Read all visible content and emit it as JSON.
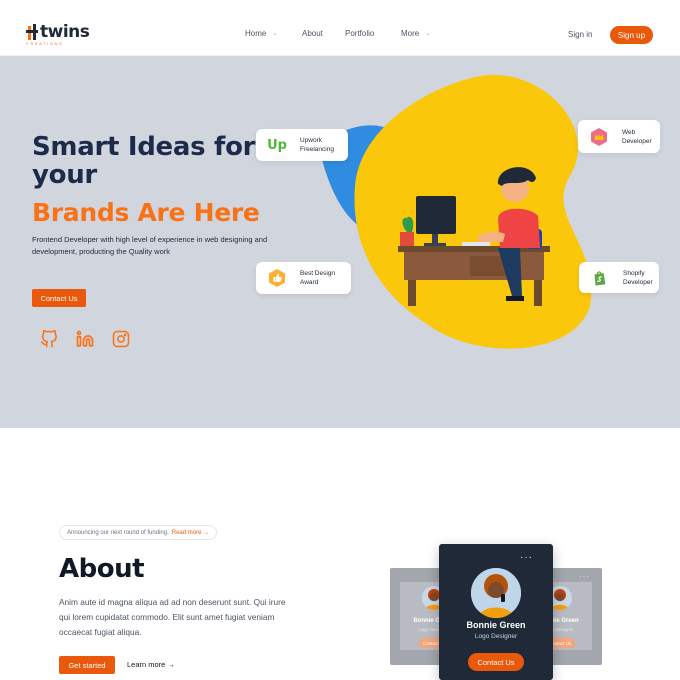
{
  "header": {
    "logo_text": "twins",
    "logo_sub": "creations",
    "nav": [
      {
        "label": "Home",
        "has_dropdown": true
      },
      {
        "label": "About",
        "has_dropdown": false
      },
      {
        "label": "Portfolio",
        "has_dropdown": false
      },
      {
        "label": "More",
        "has_dropdown": true
      }
    ],
    "signin_label": "Sign in",
    "signup_label": "Sign up"
  },
  "hero": {
    "title": "Smart Ideas for your",
    "title_accent": "Brands Are Here",
    "description": "Frontend Developer with high level of experience in web designing and development, producting the Quality work",
    "cta_label": "Contact Us",
    "socials": [
      {
        "icon": "github-icon"
      },
      {
        "icon": "linkedin-icon"
      },
      {
        "icon": "instagram-icon"
      }
    ],
    "cards": {
      "upwork": "Upwork Freelancing",
      "web": "Web Developer",
      "award": "Best Design Award",
      "shopify": "Shopify Developer"
    }
  },
  "about": {
    "announce_text": "Announcing our next round of funding.",
    "announce_link": "Read more →",
    "title": "About",
    "text": "Anim aute id magna aliqua ad ad non deserunt sunt. Qui irure qui lorem cupidatat commodo. Elit sunt amet fugiat veniam occaecat fugiat aliqua.",
    "cta_label": "Get started",
    "learn_more": "Learn more →",
    "profile": {
      "name": "Bonnie Green",
      "role": "Logo Designer",
      "button": "Contact Us",
      "dots": "···"
    },
    "profile_side": {
      "name": "Bonnie Green",
      "role": "Logo Designer",
      "button": "Contact Us"
    }
  },
  "colors": {
    "accent": "#ea580c",
    "accent_light": "#f97316",
    "hero_bg": "#d1d5de",
    "navy": "#1e2a4a",
    "blob_yellow": "#fbc70a",
    "blob_blue": "#2f8ce0"
  }
}
